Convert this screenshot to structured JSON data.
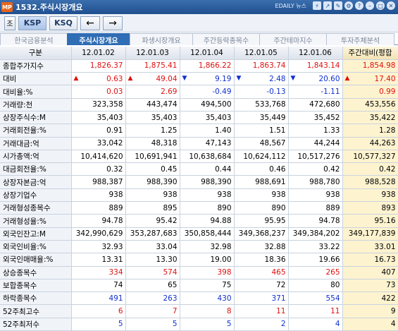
{
  "titlebar": {
    "logo": "MP",
    "title": "1532.주식시장개요",
    "brand": "EDAILY 뉴스"
  },
  "toolbar": {
    "first": "조",
    "markets": [
      "KSP",
      "KSQ"
    ],
    "prev": "←",
    "next": "→"
  },
  "tabs": [
    "한국금융분석",
    "주식시장개요",
    "파생시장개요",
    "주간등락종목수",
    "주간테마지수",
    "투자주체분석"
  ],
  "active_tab": 1,
  "table": {
    "headers": [
      "구분",
      "12.01.02",
      "12.01.03",
      "12.01.04",
      "12.01.05",
      "12.01.06",
      "주간대비(평합"
    ],
    "rows": [
      {
        "label": "종합주가지수",
        "values": [
          "1,826.37",
          "1,875.41",
          "1,866.22",
          "1,863.74",
          "1,843.14",
          "1,854.98"
        ],
        "colors": [
          "up",
          "up",
          "up",
          "up",
          "up",
          "up"
        ]
      },
      {
        "label": "대비",
        "values": [
          "0.63",
          "49.04",
          "9.19",
          "2.48",
          "20.60",
          "17.40"
        ],
        "colors": [
          "up",
          "up",
          "down",
          "down",
          "down",
          "up"
        ],
        "symbols": [
          "▲",
          "▲",
          "▼",
          "▼",
          "▼",
          "▲"
        ]
      },
      {
        "label": "대비율:%",
        "values": [
          "0.03",
          "2.69",
          "-0.49",
          "-0.13",
          "-1.11",
          "0.99"
        ],
        "colors": [
          "up",
          "up",
          "down",
          "down",
          "down",
          "up"
        ]
      },
      {
        "label": "거래량:천",
        "values": [
          "323,358",
          "443,474",
          "494,500",
          "533,768",
          "472,680",
          "453,556"
        ]
      },
      {
        "label": "상장주식수:M",
        "values": [
          "35,403",
          "35,403",
          "35,403",
          "35,449",
          "35,452",
          "35,422"
        ]
      },
      {
        "label": "거래회전율:%",
        "values": [
          "0.91",
          "1.25",
          "1.40",
          "1.51",
          "1.33",
          "1.28"
        ]
      },
      {
        "label": "거래대금:억",
        "values": [
          "33,042",
          "48,318",
          "47,143",
          "48,567",
          "44,244",
          "44,263"
        ]
      },
      {
        "label": "시가총액:억",
        "values": [
          "10,414,620",
          "10,691,941",
          "10,638,684",
          "10,624,112",
          "10,517,276",
          "10,577,327"
        ]
      },
      {
        "label": "대금회전율:%",
        "values": [
          "0.32",
          "0.45",
          "0.44",
          "0.46",
          "0.42",
          "0.42"
        ]
      },
      {
        "label": "상장자본금:억",
        "values": [
          "988,387",
          "988,390",
          "988,390",
          "988,691",
          "988,780",
          "988,528"
        ]
      },
      {
        "label": "상장기업수",
        "values": [
          "938",
          "938",
          "938",
          "938",
          "938",
          "938"
        ]
      },
      {
        "label": "거래형성종목수",
        "values": [
          "889",
          "895",
          "890",
          "890",
          "889",
          "893"
        ]
      },
      {
        "label": "거래형성율:%",
        "values": [
          "94.78",
          "95.42",
          "94.88",
          "95.95",
          "94.78",
          "95.16"
        ]
      },
      {
        "label": "외국인잔고:M",
        "values": [
          "342,990,629",
          "353,287,683",
          "350,858,444",
          "349,368,237",
          "349,384,202",
          "349,177,839"
        ]
      },
      {
        "label": "외국인비율:%",
        "values": [
          "32.93",
          "33.04",
          "32.98",
          "32.88",
          "33.22",
          "33.01"
        ]
      },
      {
        "label": "외국인매매율:%",
        "values": [
          "13.31",
          "13.30",
          "19.00",
          "18.36",
          "19.66",
          "16.73"
        ]
      },
      {
        "label": "상승종목수",
        "values": [
          "334",
          "574",
          "398",
          "465",
          "265",
          "407"
        ],
        "colors": [
          "up",
          "up",
          "up",
          "up",
          "up",
          ""
        ]
      },
      {
        "label": "보합종목수",
        "values": [
          "74",
          "65",
          "75",
          "72",
          "80",
          "73"
        ]
      },
      {
        "label": "하락종목수",
        "values": [
          "491",
          "263",
          "430",
          "371",
          "554",
          "422"
        ],
        "colors": [
          "down",
          "down",
          "down",
          "down",
          "down",
          ""
        ]
      },
      {
        "label": "52주최고수",
        "values": [
          "6",
          "7",
          "8",
          "11",
          "11",
          "9"
        ],
        "colors": [
          "up",
          "up",
          "up",
          "up",
          "up",
          ""
        ]
      },
      {
        "label": "52주최저수",
        "values": [
          "5",
          "5",
          "5",
          "2",
          "4",
          "4"
        ],
        "colors": [
          "down",
          "down",
          "down",
          "down",
          "down",
          ""
        ]
      }
    ]
  },
  "colors": {
    "up": "#e01010",
    "down": "#1030d0",
    "last_col_bg": "#fdf3cf",
    "title_bg": "#1f4f8f"
  }
}
